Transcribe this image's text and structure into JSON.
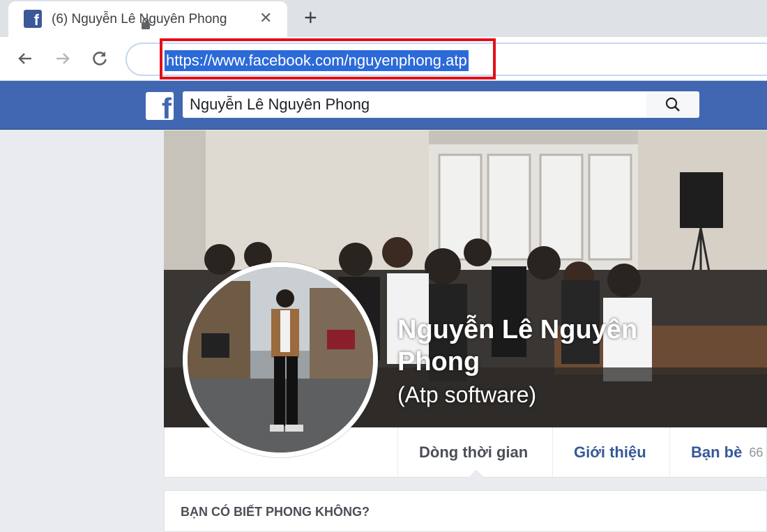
{
  "browser": {
    "tab_title": "(6) Nguyễn Lê Nguyên Phong",
    "tab_close": "✕",
    "new_tab": "+",
    "url": "https://www.facebook.com/nguyenphong.atp",
    "highlight_color": "#e0101a"
  },
  "facebook": {
    "brand_color": "#4267b2",
    "logo": "f",
    "search_value": "Nguyễn Lê Nguyên Phong"
  },
  "profile": {
    "name_line1": "Nguyễn Lê Nguyên",
    "name_line2": "Phong",
    "alternate_name": "(Atp software)",
    "tabs": [
      {
        "label": "Dòng thời gian"
      },
      {
        "label": "Giới thiệu"
      },
      {
        "label": "Bạn bè",
        "count": "66"
      }
    ],
    "pymk_title": "BẠN CÓ BIẾT PHONG KHÔNG?"
  }
}
